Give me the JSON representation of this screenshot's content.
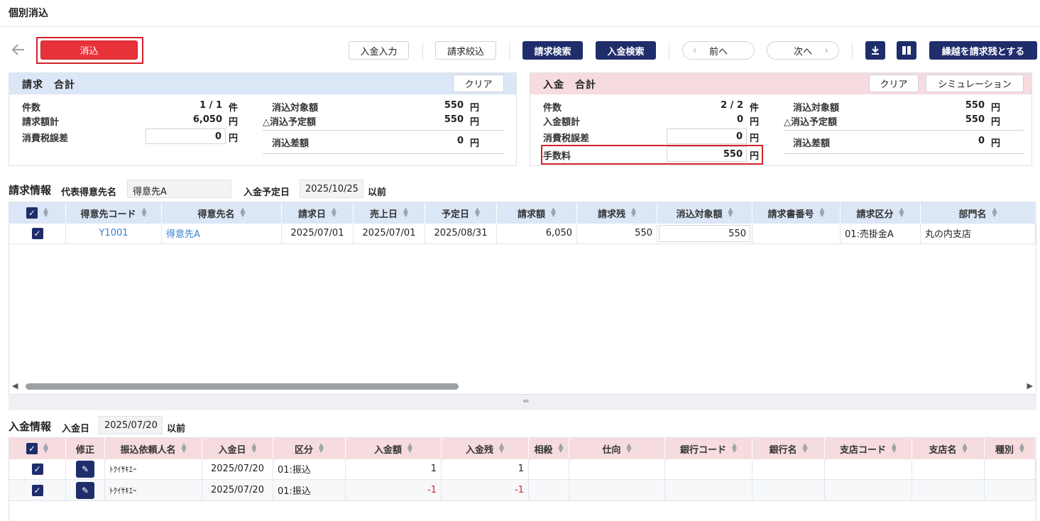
{
  "page_title": "個別消込",
  "toolbar": {
    "keshikomi": "消込",
    "nyukin_input": "入金入力",
    "seikyu_filter": "請求絞込",
    "seikyu_search": "請求検索",
    "nyukin_search": "入金検索",
    "prev": "前へ",
    "next": "次へ",
    "carry_over": "繰越を請求残とする"
  },
  "invoice_summary": {
    "title": "請求　合計",
    "clear": "クリア",
    "count_label": "件数",
    "count_value": "1 / 1",
    "count_unit": "件",
    "total_label": "請求額計",
    "total_value": "6,050",
    "total_unit": "円",
    "tax_label": "消費税誤差",
    "tax_value": "0",
    "tax_unit": "円",
    "target_label": "消込対象額",
    "target_value": "550",
    "target_unit": "円",
    "planned_label": "△消込予定額",
    "planned_value": "550",
    "planned_unit": "円",
    "diff_label": "消込差額",
    "diff_value": "0",
    "diff_unit": "円"
  },
  "payment_summary": {
    "title": "入金　合計",
    "clear": "クリア",
    "simulation": "シミュレーション",
    "count_label": "件数",
    "count_value": "2 / 2",
    "count_unit": "件",
    "total_label": "入金額計",
    "total_value": "0",
    "total_unit": "円",
    "tax_label": "消費税誤差",
    "tax_value": "0",
    "tax_unit": "円",
    "fee_label": "手数料",
    "fee_value": "550",
    "fee_unit": "円",
    "target_label": "消込対象額",
    "target_value": "550",
    "target_unit": "円",
    "planned_label": "△消込予定額",
    "planned_value": "550",
    "planned_unit": "円",
    "diff_label": "消込差額",
    "diff_value": "0",
    "diff_unit": "円"
  },
  "invoice_info": {
    "title": "請求情報",
    "rep_label": "代表得意先名",
    "rep_value": "得意先A",
    "date_label": "入金予定日",
    "date_value": "2025/10/25",
    "date_suffix": "以前",
    "headers": [
      "得意先コード",
      "得意先名",
      "請求日",
      "売上日",
      "予定日",
      "請求額",
      "請求残",
      "消込対象額",
      "請求書番号",
      "請求区分",
      "部門名"
    ],
    "rows": [
      {
        "code": "Y1001",
        "name": "得意先A",
        "invoice_date": "2025/07/01",
        "sales_date": "2025/07/01",
        "due_date": "2025/08/31",
        "amount": "6,050",
        "remaining": "550",
        "target": "550",
        "number": "",
        "category": "01:売掛金A",
        "dept": "丸の内支店"
      }
    ]
  },
  "payment_info": {
    "title": "入金情報",
    "date_label": "入金日",
    "date_value": "2025/07/20",
    "date_suffix": "以前",
    "headers": [
      "修正",
      "振込依頼人名",
      "入金日",
      "区分",
      "入金額",
      "入金残",
      "相殺",
      "仕向",
      "銀行コード",
      "銀行名",
      "支店コード",
      "支店名",
      "種別"
    ],
    "rows": [
      {
        "payer": "ﾄｸｲｻｷｴｰ",
        "date": "2025/07/20",
        "kind": "01:振込",
        "amount": "1",
        "remaining": "1"
      },
      {
        "payer": "ﾄｸｲｻｷｴｰ",
        "date": "2025/07/20",
        "kind": "01:振込",
        "amount": "-1",
        "remaining": "-1"
      }
    ]
  },
  "colors": {
    "navy": "#1f2d6b",
    "red": "#e8323a",
    "invoice_head": "#dbe6f6",
    "payment_head": "#f6dbdf"
  }
}
